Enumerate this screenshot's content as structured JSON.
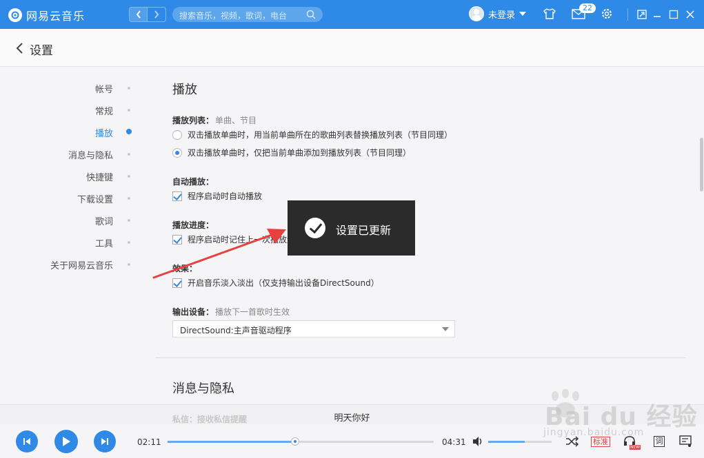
{
  "topbar": {
    "app_name": "网易云音乐",
    "search_placeholder": "搜索音乐，视频，歌词，电台",
    "user_label": "未登录",
    "message_count": "22"
  },
  "header": {
    "title": "设置"
  },
  "sidebar": {
    "items": [
      {
        "label": "帐号",
        "active": false
      },
      {
        "label": "常规",
        "active": false
      },
      {
        "label": "播放",
        "active": true
      },
      {
        "label": "消息与隐私",
        "active": false
      },
      {
        "label": "快捷键",
        "active": false
      },
      {
        "label": "下载设置",
        "active": false
      },
      {
        "label": "歌词",
        "active": false
      },
      {
        "label": "工具",
        "active": false
      },
      {
        "label": "关于网易云音乐",
        "active": false
      }
    ]
  },
  "play_section": {
    "heading": "播放",
    "playlist_label": "播放列表：",
    "playlist_hint": "单曲、节目",
    "playlist_options": [
      {
        "text": "双击播放单曲时，用当前单曲所在的歌曲列表替换播放列表（节目同理）",
        "selected": false
      },
      {
        "text": "双击播放单曲时，仅把当前单曲添加到播放列表（节目同理）",
        "selected": true
      }
    ],
    "autoplay_label": "自动播放：",
    "autoplay_option": "程序启动时自动播放",
    "progress_label": "播放进度：",
    "progress_option": "程序启动时记住上一次播放进度",
    "effect_label": "效果：",
    "effect_option": "开启音乐淡入淡出（仅支持输出设备DirectSound）",
    "output_label": "输出设备：",
    "output_hint": "播放下一首歌时生效",
    "output_value": "DirectSound:主声音驱动程序"
  },
  "privacy_section": {
    "heading": "消息与隐私",
    "faded_label": "私信：接收私信提醒"
  },
  "toast": {
    "text": "设置已更新"
  },
  "now_playing": {
    "title": "明天你好"
  },
  "player": {
    "elapsed": "02:11",
    "duration": "04:31",
    "progress_fraction": 0.48,
    "volume_fraction": 0.58,
    "quality_label": "标准",
    "new_tag": "NEW",
    "lyric_label": "词"
  },
  "watermark": {
    "brand": "Bai du 经验",
    "url": "jingyan.baidu.com"
  },
  "colors": {
    "accent": "#2e8ae6",
    "toast_bg": "#2b2b2b",
    "arrow": "#e8403f"
  }
}
